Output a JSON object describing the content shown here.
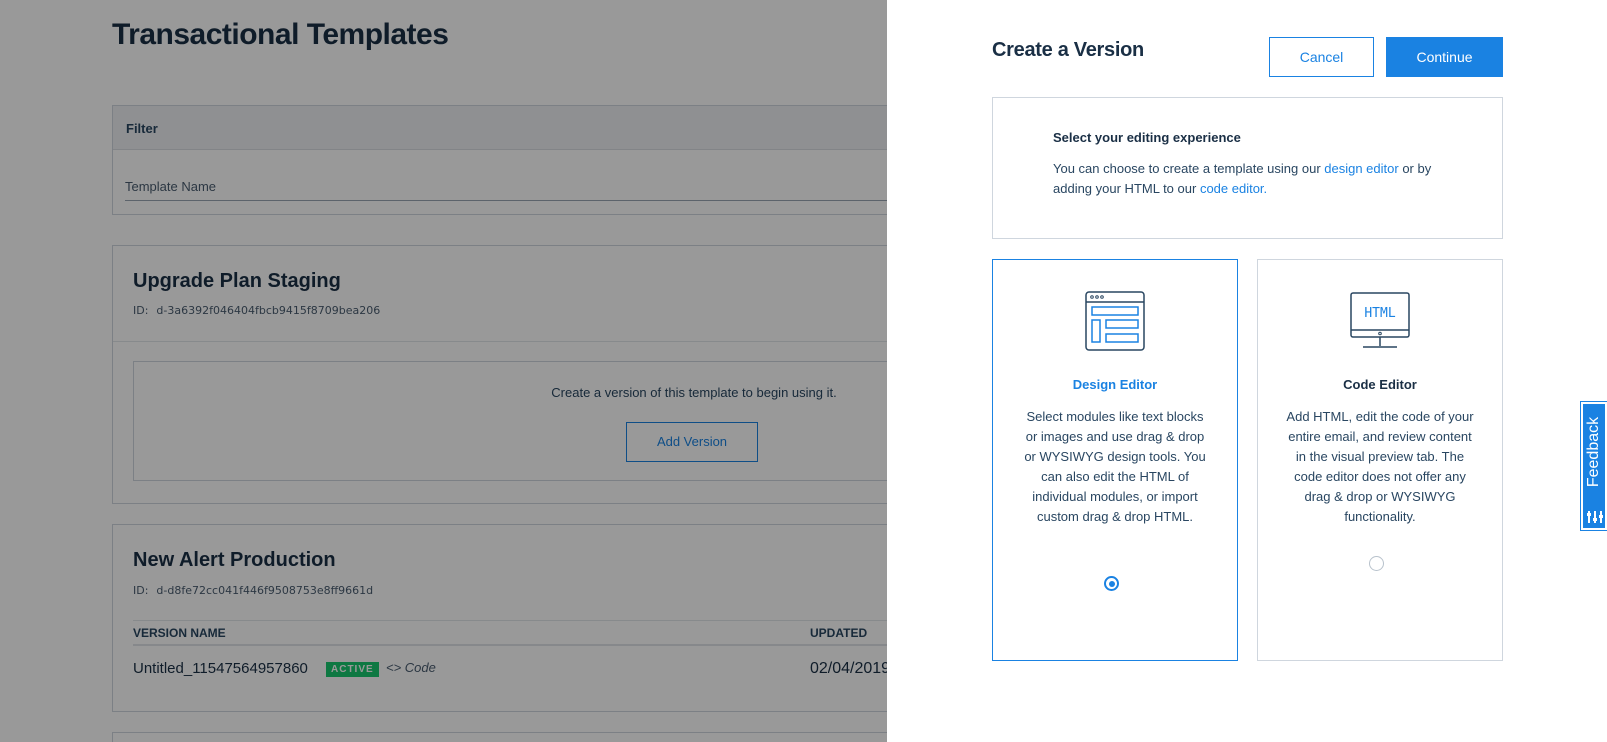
{
  "background": {
    "page_title": "Transactional Templates",
    "filter": {
      "header": "Filter",
      "field_label": "Template Name"
    },
    "templates": [
      {
        "name": "Upgrade Plan Staging",
        "id_label": "ID:",
        "id": "d-3a6392f046404fbcb9415f8709bea206",
        "empty_message": "Create a version of this template to begin using it.",
        "add_version_label": "Add Version"
      },
      {
        "name": "New Alert Production",
        "id_label": "ID:",
        "id": "d-d8fe72cc041f446f9508753e8ff9661d",
        "columns": [
          "VERSION NAME",
          "UPDATED"
        ],
        "versions": [
          {
            "name": "Untitled_11547564957860",
            "badge": "ACTIVE",
            "type_label": "Code",
            "updated": "02/04/2019"
          }
        ]
      }
    ]
  },
  "panel": {
    "title": "Create a Version",
    "cancel_label": "Cancel",
    "continue_label": "Continue",
    "info": {
      "heading": "Select your editing experience",
      "text_before": "You can choose to create a template using our ",
      "link1": "design editor",
      "text_middle": " or by adding your HTML to our ",
      "link2": "code editor."
    },
    "options": [
      {
        "label": "Design Editor",
        "icon": "design-layout-icon",
        "description": "Select modules like text blocks or images and use drag & drop or WYSIWYG design tools. You can also edit the HTML of individual modules, or import custom drag & drop HTML.",
        "selected": true
      },
      {
        "label": "Code Editor",
        "icon": "html-monitor-icon",
        "icon_text": "HTML",
        "description": "Add HTML, edit the code of your entire email, and review content in the visual preview tab. The code editor does not offer any drag & drop or WYSIWYG functionality.",
        "selected": false
      }
    ]
  },
  "feedback": {
    "label": "Feedback",
    "icon": "sliders-icon"
  },
  "colors": {
    "accent": "#1a82e2",
    "text_dark": "#1a2f45",
    "active_badge": "#18c96e",
    "overlay": "rgba(0,0,0,0.4)"
  }
}
